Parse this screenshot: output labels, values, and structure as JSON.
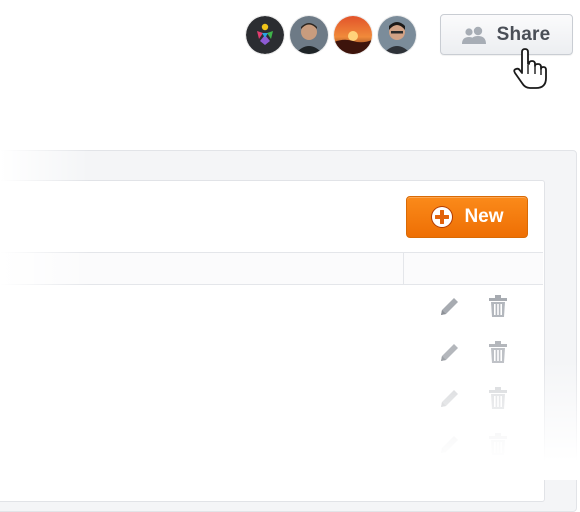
{
  "header": {
    "collaborators": [
      {
        "name": "avatar-logo",
        "icon": "colorful-figure-logo"
      },
      {
        "name": "avatar-user-1",
        "icon": "person-photo"
      },
      {
        "name": "avatar-user-2",
        "icon": "sunset-photo"
      },
      {
        "name": "avatar-user-3",
        "icon": "person-photo"
      }
    ],
    "share_button": {
      "label": "Share",
      "icon": "people-icon"
    }
  },
  "toolbar": {
    "new_button": {
      "label": "New",
      "icon": "plus-circle-icon",
      "color": "#f57a0c"
    }
  },
  "table": {
    "rows": [
      {
        "actions": [
          "edit-icon",
          "trash-icon"
        ]
      },
      {
        "actions": [
          "edit-icon",
          "trash-icon"
        ]
      },
      {
        "actions": [
          "edit-icon",
          "trash-icon"
        ]
      },
      {
        "actions": [
          "edit-icon",
          "trash-icon"
        ]
      }
    ]
  },
  "colors": {
    "accent": "#f57a0c",
    "icon_gray": "#a7abb1",
    "button_text": "#4a4f57"
  }
}
